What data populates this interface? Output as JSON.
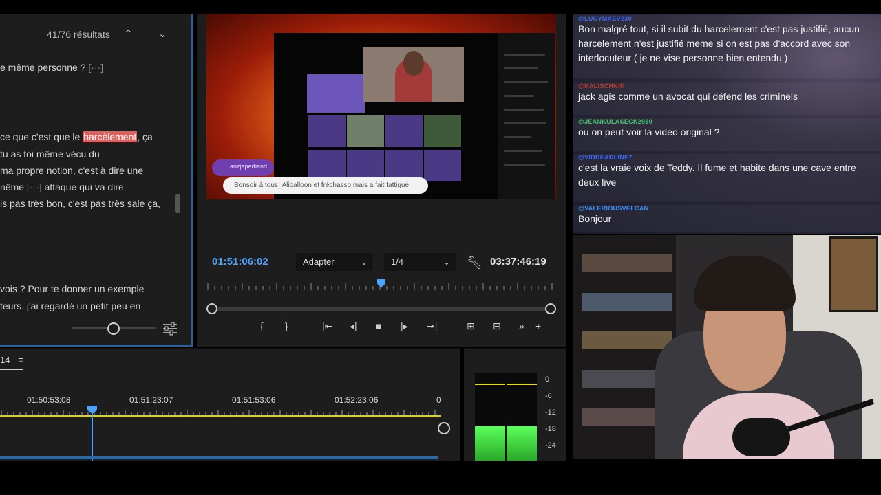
{
  "transcript": {
    "results": "41/76 résultats",
    "prev_icon": "chevron-up-icon",
    "next_icon": "chevron-down-icon",
    "line1": "e même personne ?",
    "line1_ellipsis": "[···]",
    "line2_pre": "ce que c'est que le ",
    "line2_hit": "harcèlement",
    "line2_post": ", ça",
    "line3": " tu as toi même vécu du",
    "line4": "ma propre notion, c'est à dire une",
    "line5_pre": "nême ",
    "line5_ellipsis": "[···]",
    "line5_post": " attaque qui va dire",
    "line6": "is pas très bon, c'est pas très sale ça,",
    "line7": " vois ? Pour te donner un exemple",
    "line8": "teurs. j'ai regardé un petit peu en"
  },
  "monitor": {
    "current_timecode": "01:51:06:02",
    "fit_label": "Adapter",
    "resolution_label": "1/4",
    "duration_timecode": "03:37:46:19",
    "video_caption": "Bonsoir à tous_Aliballoon et fréchasso mais a fait fattigué",
    "video_badge": "anzjapertiend"
  },
  "transport": [
    "{",
    "}",
    "|⇤",
    "◂|",
    "■",
    "|▸",
    "⇥|",
    "⊞",
    "⊟",
    "»",
    "+"
  ],
  "timeline": {
    "sequence_label": "14",
    "times": [
      "01:50:53:08",
      "01:51:23:07",
      "01:51:53:06",
      "01:52:23:06",
      "0"
    ]
  },
  "meter": {
    "scale": [
      "0",
      "-6",
      "-12",
      "-18",
      "-24"
    ],
    "level_left": 0.62,
    "level_right": 0.62
  },
  "chat": [
    {
      "user": "@LUCYMAEV230",
      "color": "#3a67ff",
      "text": "Bon malgré tout, si il subit du harcelement c'est pas justifié, aucun harcelement n'est justifié meme si on est pas d'accord avec son interlocuteur ( je ne vise personne bien entendu )"
    },
    {
      "user": "@KALISCHNIK",
      "color": "#c0392b",
      "text": "jack agis comme un avocat qui défend les criminels"
    },
    {
      "user": "@JEANKULASECK2950",
      "color": "#3ec46d",
      "text": "ou on peut voir la video original ?"
    },
    {
      "user": "@VIDDEADLINE7",
      "color": "#3a67ff",
      "text": "c'est la vraie voix de Teddy. Il fume et habite dans une cave entre deux live"
    },
    {
      "user": "@VALERIOUSVELCAN",
      "color": "#3a8dff",
      "text": "Bonjour"
    }
  ],
  "colors": {
    "accent": "#4aa3ff",
    "highlight": "#e0605d",
    "workarea": "#d8d02a"
  }
}
